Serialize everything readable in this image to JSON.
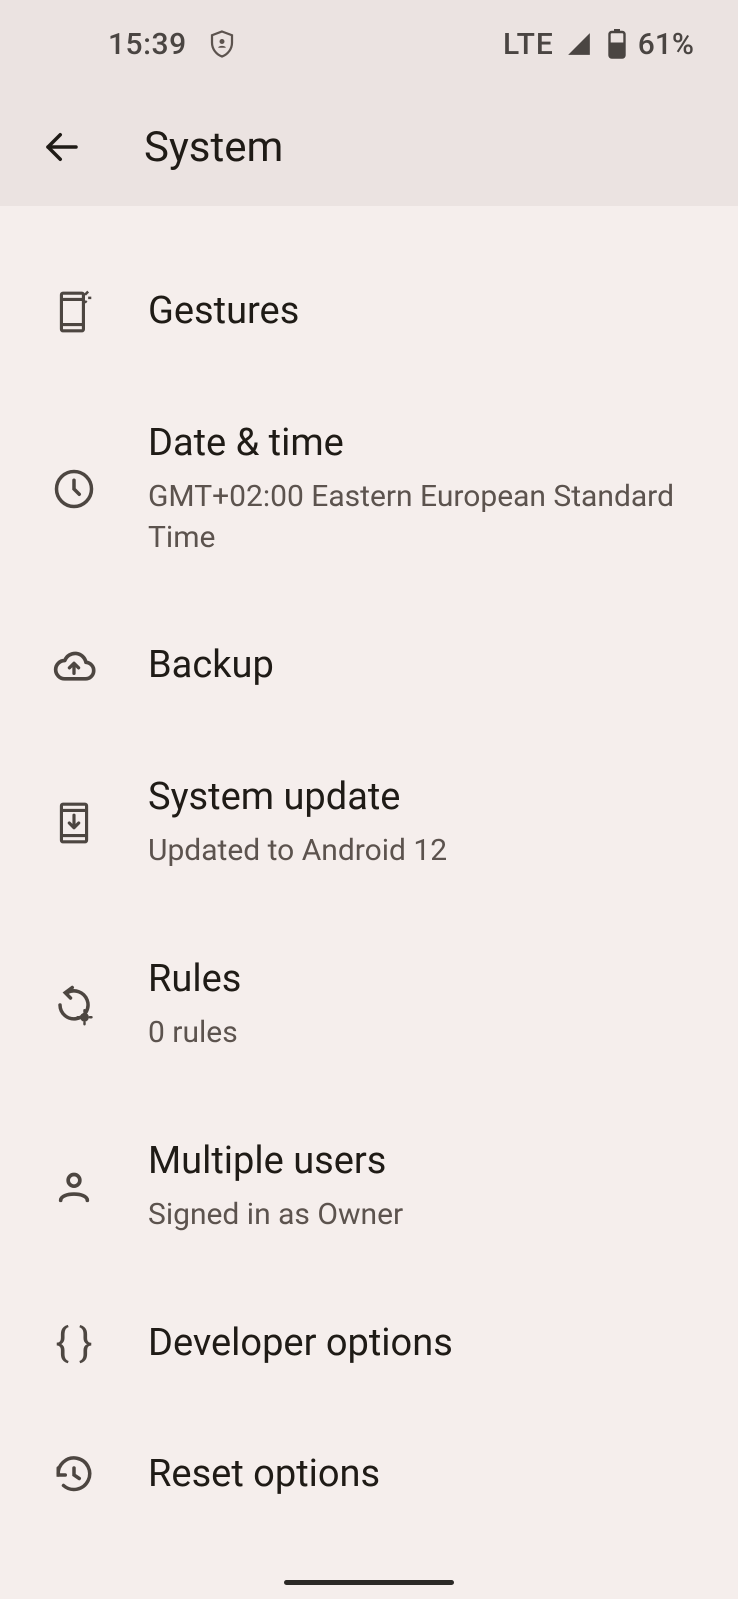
{
  "statusbar": {
    "time": "15:39",
    "network": "LTE",
    "battery": "61%"
  },
  "appbar": {
    "title": "System"
  },
  "items": {
    "gestures": {
      "title": "Gestures"
    },
    "datetime": {
      "title": "Date & time",
      "sub": "GMT+02:00 Eastern European Standard Time"
    },
    "backup": {
      "title": "Backup"
    },
    "sysupdate": {
      "title": "System update",
      "sub": "Updated to Android 12"
    },
    "rules": {
      "title": "Rules",
      "sub": "0 rules"
    },
    "users": {
      "title": "Multiple users",
      "sub": "Signed in as Owner"
    },
    "devopts": {
      "title": "Developer options"
    },
    "reset": {
      "title": "Reset options"
    }
  }
}
